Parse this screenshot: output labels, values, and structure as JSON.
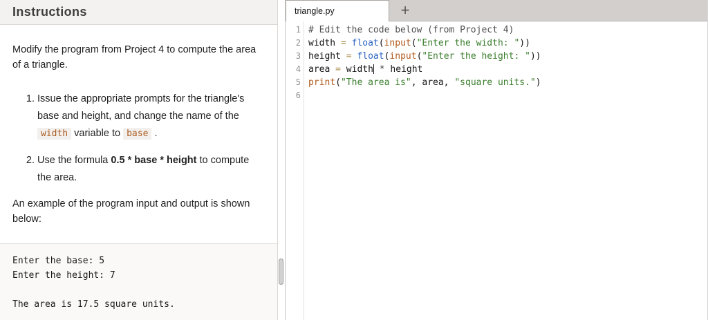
{
  "instructions": {
    "title": "Instructions",
    "intro": "Modify the program from Project 4 to compute the area of a triangle.",
    "steps": [
      {
        "parts": [
          {
            "t": "text",
            "v": "Issue the appropriate prompts for the triangle's base and height, and change the name of the "
          },
          {
            "t": "code",
            "v": "width"
          },
          {
            "t": "text",
            "v": " variable to "
          },
          {
            "t": "code",
            "v": "base"
          },
          {
            "t": "text",
            "v": " ."
          }
        ]
      },
      {
        "parts": [
          {
            "t": "text",
            "v": "Use the formula "
          },
          {
            "t": "bold",
            "v": "0.5 * base * height"
          },
          {
            "t": "text",
            "v": " to compute the area."
          }
        ]
      }
    ],
    "example_intro": "An example of the program input and output is shown below:",
    "example_lines": [
      "Enter the base: 5",
      "Enter the height: 7",
      "",
      "The area is 17.5 square units."
    ]
  },
  "editor": {
    "tab": "triangle.py",
    "new_tab_label": "+",
    "lines": [
      {
        "no": "1",
        "tokens": [
          {
            "c": "comment",
            "v": "# Edit the code below (from Project 4)"
          }
        ]
      },
      {
        "no": "2",
        "tokens": [
          {
            "c": "plain",
            "v": "width "
          },
          {
            "c": "op",
            "v": "="
          },
          {
            "c": "plain",
            "v": " "
          },
          {
            "c": "builtin",
            "v": "float"
          },
          {
            "c": "plain",
            "v": "("
          },
          {
            "c": "func",
            "v": "input"
          },
          {
            "c": "plain",
            "v": "("
          },
          {
            "c": "string",
            "v": "\"Enter the width: \""
          },
          {
            "c": "plain",
            "v": "))"
          }
        ]
      },
      {
        "no": "3",
        "tokens": [
          {
            "c": "plain",
            "v": "height "
          },
          {
            "c": "op",
            "v": "="
          },
          {
            "c": "plain",
            "v": " "
          },
          {
            "c": "builtin",
            "v": "float"
          },
          {
            "c": "plain",
            "v": "("
          },
          {
            "c": "func",
            "v": "input"
          },
          {
            "c": "plain",
            "v": "("
          },
          {
            "c": "string",
            "v": "\"Enter the height: \""
          },
          {
            "c": "plain",
            "v": "))"
          }
        ]
      },
      {
        "no": "4",
        "tokens": [
          {
            "c": "plain",
            "v": "area "
          },
          {
            "c": "op",
            "v": "="
          },
          {
            "c": "plain",
            "v": " width"
          },
          {
            "c": "caret",
            "v": ""
          },
          {
            "c": "plain",
            "v": " "
          },
          {
            "c": "star",
            "v": "*"
          },
          {
            "c": "plain",
            "v": " height"
          }
        ]
      },
      {
        "no": "5",
        "tokens": [
          {
            "c": "func",
            "v": "print"
          },
          {
            "c": "plain",
            "v": "("
          },
          {
            "c": "string",
            "v": "\"The area is\""
          },
          {
            "c": "plain",
            "v": ", area, "
          },
          {
            "c": "string",
            "v": "\"square units.\""
          },
          {
            "c": "plain",
            "v": ")"
          }
        ]
      },
      {
        "no": "6",
        "tokens": []
      }
    ]
  },
  "colors": {
    "header_bg": "#f4f2f1",
    "tabbar_bg": "#d3cfcc",
    "code_chip_fg": "#a95a1e",
    "syntax_comment": "#4f4f4f",
    "syntax_builtin": "#2e66c2",
    "syntax_function": "#b25a1d",
    "syntax_string": "#3a7d2c",
    "syntax_operator": "#a3853f"
  }
}
